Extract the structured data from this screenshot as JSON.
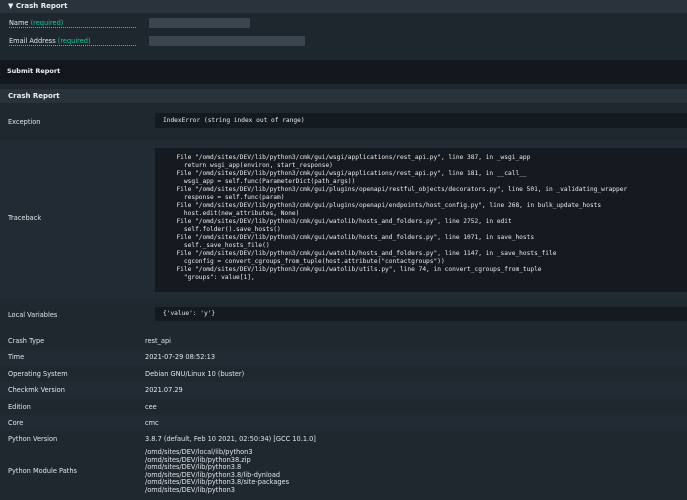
{
  "form": {
    "title": "Crash Report",
    "fields": [
      {
        "label": "Name",
        "required": "(required)",
        "value": ""
      },
      {
        "label": "Email Address",
        "required": "(required)",
        "value": ""
      }
    ],
    "submit_label": "Submit Report"
  },
  "report": {
    "title": "Crash Report",
    "exception_label": "Exception",
    "exception": "IndexError (string index out of range)",
    "traceback_label": "Traceback",
    "traceback": [
      "  File \"/omd/sites/DEV/lib/python3/cmk/gui/wsgi/applications/rest_api.py\", line 387, in _wsgi_app",
      "    return wsgi_app(environ, start_response)",
      "  File \"/omd/sites/DEV/lib/python3/cmk/gui/wsgi/applications/rest_api.py\", line 181, in __call__",
      "    wsgi_app = self.func(ParameterDict(path_args))",
      "  File \"/omd/sites/DEV/lib/python3/cmk/gui/plugins/openapi/restful_objects/decorators.py\", line 501, in _validating_wrapper",
      "    response = self.func(param)",
      "  File \"/omd/sites/DEV/lib/python3/cmk/gui/plugins/openapi/endpoints/host_config.py\", line 268, in bulk_update_hosts",
      "    host.edit(new_attributes, None)",
      "  File \"/omd/sites/DEV/lib/python3/cmk/gui/watolib/hosts_and_folders.py\", line 2752, in edit",
      "    self.folder().save_hosts()",
      "  File \"/omd/sites/DEV/lib/python3/cmk/gui/watolib/hosts_and_folders.py\", line 1071, in save_hosts",
      "    self._save_hosts_file()",
      "  File \"/omd/sites/DEV/lib/python3/cmk/gui/watolib/hosts_and_folders.py\", line 1147, in _save_hosts_file",
      "    cgconfig = convert_cgroups_from_tuple(host.attribute(\"contactgroups\"))",
      "  File \"/omd/sites/DEV/lib/python3/cmk/gui/watolib/utils.py\", line 74, in convert_cgroups_from_tuple",
      "    \"groups\": value[1],"
    ],
    "locals_label": "Local Variables",
    "locals": "{'value': 'y'}",
    "details": [
      {
        "label": "Crash Type",
        "value": "rest_api"
      },
      {
        "label": "Time",
        "value": "2021-07-29 08:52:13"
      },
      {
        "label": "Operating System",
        "value": "Debian GNU/Linux 10 (buster)"
      },
      {
        "label": "Checkmk Version",
        "value": "2021.07.29"
      },
      {
        "label": "Edition",
        "value": "cee"
      },
      {
        "label": "Core",
        "value": "cmc"
      },
      {
        "label": "Python Version",
        "value": "3.8.7 (default, Feb 10 2021, 02:50:34) [GCC 10.1.0]"
      }
    ],
    "paths_label": "Python Module Paths",
    "paths": [
      "/omd/sites/DEV/local/lib/python3",
      "/omd/sites/DEV/lib/python38.zip",
      "/omd/sites/DEV/lib/python3.8",
      "/omd/sites/DEV/lib/python3.8/lib-dynload",
      "/omd/sites/DEV/lib/python3.8/site-packages",
      "/omd/sites/DEV/lib/python3"
    ]
  }
}
